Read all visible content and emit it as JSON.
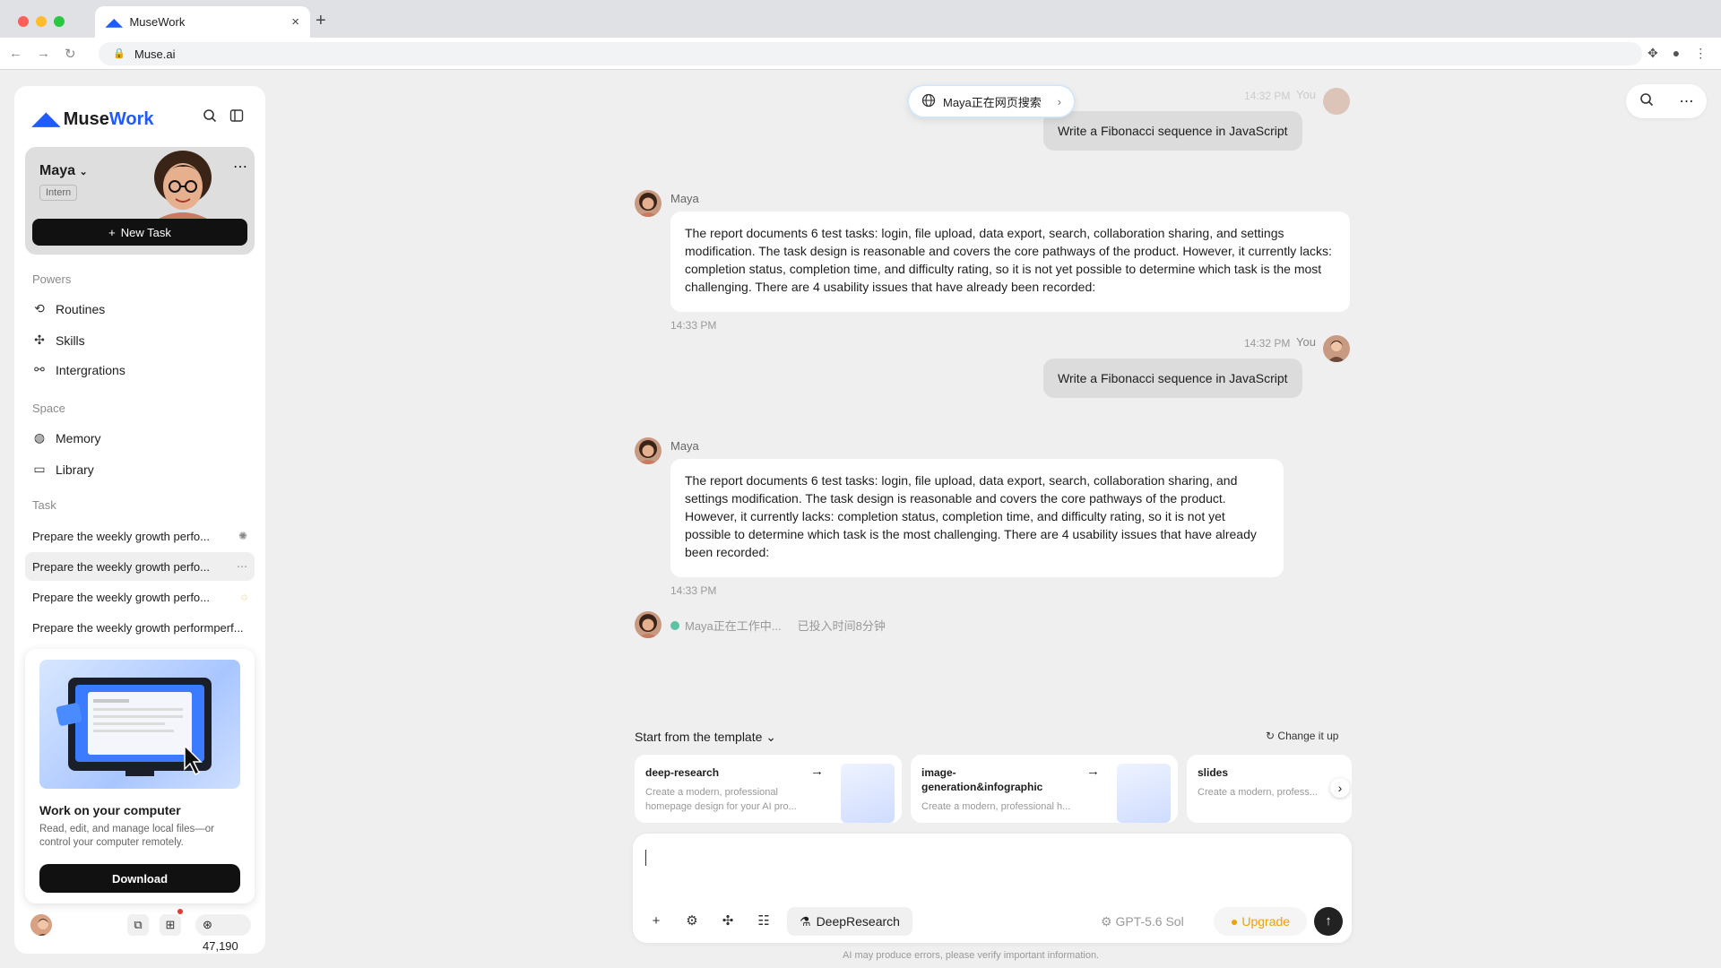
{
  "browser": {
    "tab_title": "MuseWork",
    "url": "Muse.ai"
  },
  "sidebar": {
    "brand_prefix": "Muse",
    "brand_suffix": "Work",
    "agent": {
      "name": "Maya",
      "role": "Intern"
    },
    "new_task_label": "New Task",
    "powers_heading": "Powers",
    "powers": [
      {
        "label": "Routines",
        "icon": "routine-icon"
      },
      {
        "label": "Skills",
        "icon": "puzzle-icon"
      },
      {
        "label": "Intergrations",
        "icon": "integrations-icon"
      }
    ],
    "space_heading": "Space",
    "space": [
      {
        "label": "Memory",
        "icon": "memory-icon"
      },
      {
        "label": "Library",
        "icon": "folder-icon"
      }
    ],
    "task_heading": "Task",
    "tasks": [
      {
        "label": "Prepare the weekly growth perfo..."
      },
      {
        "label": "Prepare the weekly growth perfo..."
      },
      {
        "label": "Prepare the weekly growth perfo..."
      },
      {
        "label": "Prepare the weekly growth performperf..."
      }
    ],
    "promo": {
      "title": "Work on your computer",
      "description": "Read, edit, and manage local files—or control your computer remotely.",
      "button_label": "Download"
    },
    "credits": "47,190"
  },
  "chat": {
    "search_pill": "Maya正在网页搜索",
    "messages": [
      {
        "role": "user",
        "time": "14:32 PM",
        "sender": "You",
        "text": "Write a Fibonacci sequence in JavaScript"
      },
      {
        "role": "assistant",
        "sender": "Maya",
        "time": "14:33 PM",
        "text": "The report documents 6 test tasks: login, file upload, data export, search, collaboration sharing, and settings modification. The task design is reasonable and covers the core pathways of the product. However, it currently lacks: completion status, completion time, and difficulty rating, so it is not yet possible to determine which task is the most challenging. There are 4 usability issues that have already been recorded:"
      },
      {
        "role": "user",
        "time": "14:32 PM",
        "sender": "You",
        "text": "Write a Fibonacci sequence in JavaScript"
      },
      {
        "role": "assistant",
        "sender": "Maya",
        "time": "14:33 PM",
        "text": "The report documents 6 test tasks: login, file upload, data export, search, collaboration sharing, and settings modification. The task design is reasonable and covers the core pathways of the product. However, it currently lacks: completion status, completion time, and difficulty rating, so it is not yet possible to determine which task is the most challenging. There are 4 usability issues that have already been recorded:"
      }
    ],
    "working_status": "Maya正在工作中...",
    "elapsed": "已投入时间8分钟"
  },
  "templates": {
    "heading": "Start from the template",
    "change_label": "Change it up",
    "cards": [
      {
        "name": "deep-research",
        "description": "Create a modern, professional homepage design for your AI pro..."
      },
      {
        "name": "image-generation&infographic",
        "description": "Create a modern, professional h..."
      },
      {
        "name": "slides",
        "description": "Create a modern, profess..."
      }
    ]
  },
  "composer": {
    "deep_research_label": "DeepResearch",
    "model": "GPT-5.6 Sol",
    "upgrade_label": "Upgrade",
    "disclaimer": "AI may produce errors, please verify important information."
  },
  "colors": {
    "accent": "#1f5bff",
    "upgrade": "#f0a000",
    "status_green": "#5ec2a4"
  }
}
